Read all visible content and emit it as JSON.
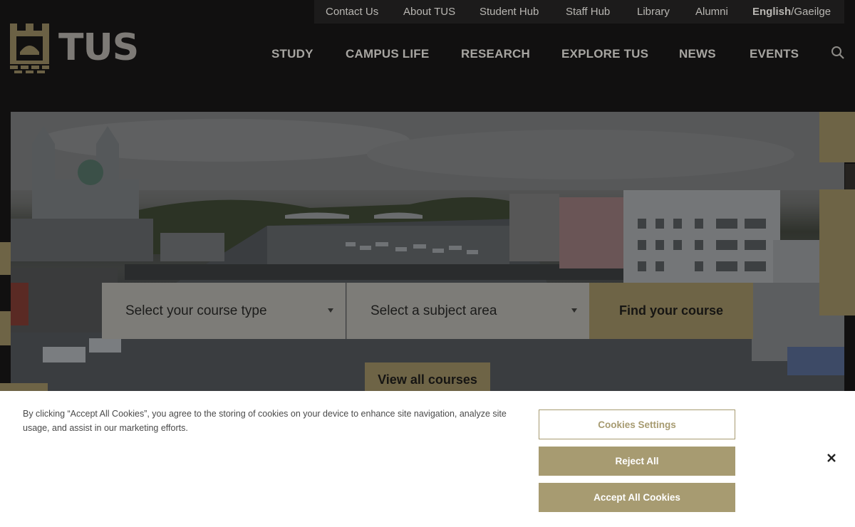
{
  "utility_nav": {
    "items": [
      "Contact Us",
      "About TUS",
      "Student Hub",
      "Staff Hub",
      "Library",
      "Alumni"
    ],
    "lang_en": "English",
    "lang_sep": "/",
    "lang_ga": "Gaeilge"
  },
  "brand": {
    "name": "TUS"
  },
  "main_nav": {
    "items": [
      "STUDY",
      "CAMPUS LIFE",
      "RESEARCH",
      "EXPLORE TUS",
      "NEWS",
      "EVENTS"
    ],
    "search_icon": "search-icon"
  },
  "course_search": {
    "course_type": "Select your course type",
    "subject_area": "Select a subject area",
    "find_button": "Find your course",
    "view_all": "View all courses"
  },
  "cookie_banner": {
    "text": "By clicking “Accept All Cookies”, you agree to the storing of cookies on your device to enhance site navigation, analyze site usage, and assist in our marketing efforts.",
    "settings_button": "Cookies Settings",
    "reject_button": "Reject All",
    "accept_button": "Accept All Cookies",
    "close_icon": "close-icon"
  },
  "colors": {
    "accent": "#a79b71",
    "background": "#111010",
    "overlay_accent": "#6e6446"
  }
}
